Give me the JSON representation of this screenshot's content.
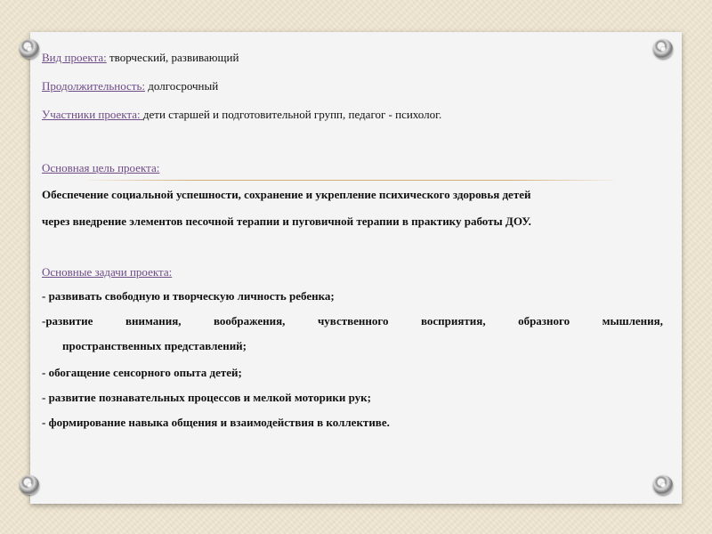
{
  "project_type": {
    "label": "Вид проекта:",
    "value": " творческий, развивающий"
  },
  "duration": {
    "label": "Продолжительность:",
    "value": " долгосрочный"
  },
  "participants": {
    "label": "Участники проекта: ",
    "value": " дети старшей и подготовительной групп, педагог - психолог."
  },
  "main_goal": {
    "label": "Основная цель проекта:",
    "line1": "Обеспечение социальной успешности, сохранение и укрепление психического здоровья детей",
    "line2": "через внедрение элементов песочной терапии и пуговичной терапии в практику работы ДОУ."
  },
  "tasks": {
    "label": "Основные задачи проекта:",
    "item1": "- развивать свободную и творческую личность ребенка;",
    "item2_words": [
      "-развитие",
      "внимания,",
      "воображения,",
      "чувственного",
      "восприятия,",
      "образного",
      "мышления,"
    ],
    "item2_cont": "пространственных представлений;",
    "item3": "- обогащение сенсорного опыта детей;",
    "item4": "- развитие познавательных процессов и мелкой моторики рук;",
    "item5": "- формирование навыка общения и взаимодействия в коллективе."
  }
}
